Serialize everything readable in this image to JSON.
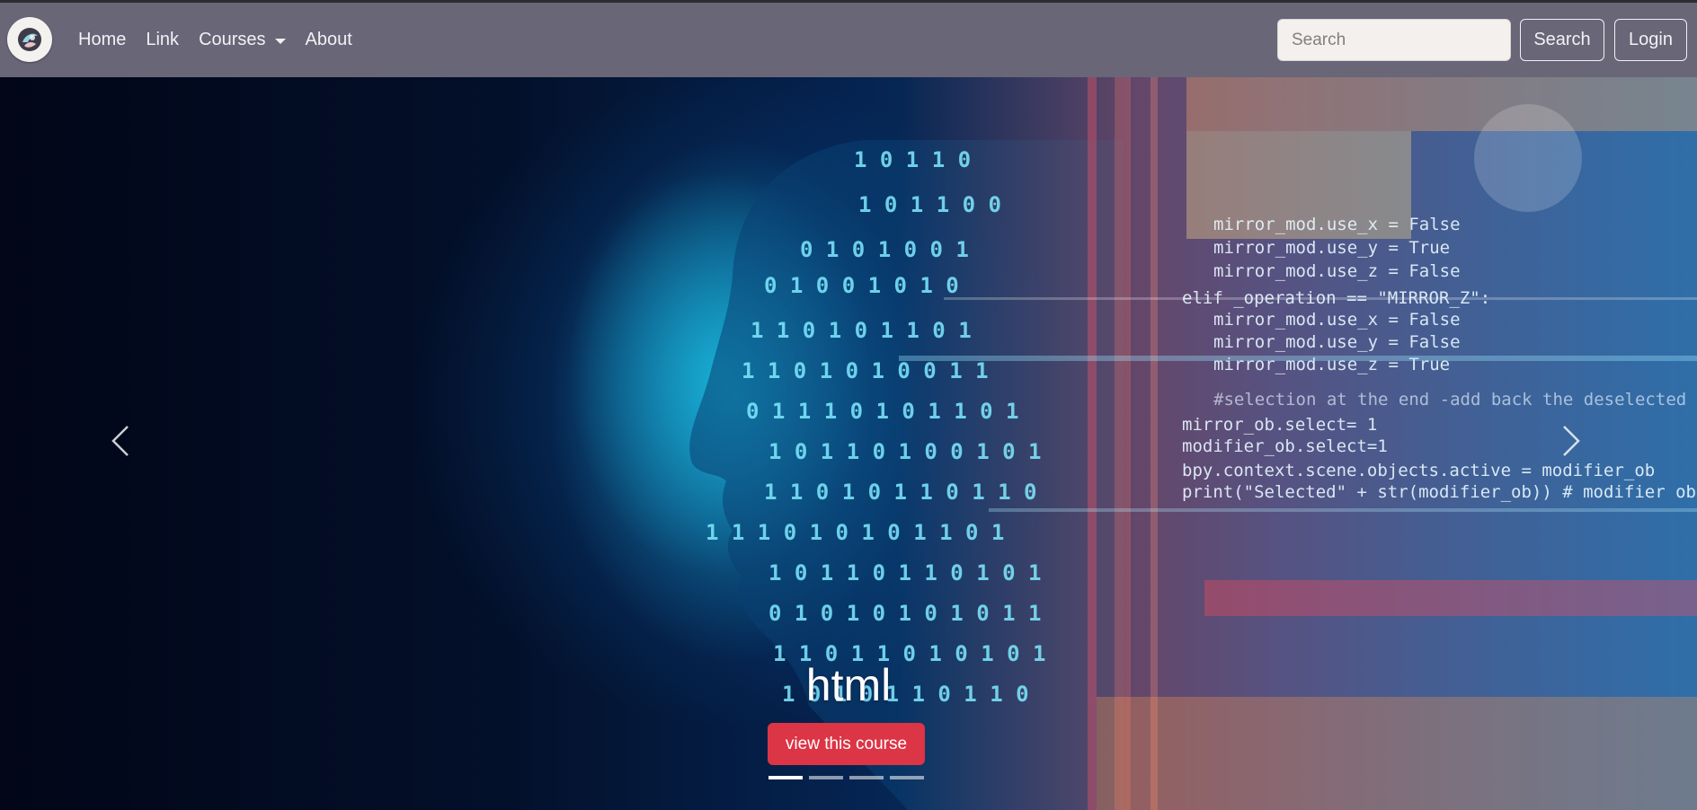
{
  "navbar": {
    "brand_logo": "brand-logo-icon",
    "links": [
      {
        "label": "Home"
      },
      {
        "label": "Link"
      },
      {
        "label": "Courses"
      },
      {
        "label": "About"
      }
    ],
    "search": {
      "placeholder": "Search",
      "value": ""
    },
    "search_button": "Search",
    "login_button": "Login"
  },
  "carousel": {
    "slide": {
      "title": "html",
      "button_label": "view this course"
    },
    "prev_icon": "chevron-left-icon",
    "next_icon": "chevron-right-icon",
    "indicators_count": 4,
    "active_indicator": 1,
    "colors": {
      "button": "#dc3545",
      "navbar": "#686677"
    },
    "background_code_text": [
      "mirror_mod.use_x = False",
      "mirror_mod.use_y = True",
      "mirror_mod.use_z = False",
      "elif _operation == \"MIRROR_Z\":",
      "mirror_mod.use_x = False",
      "mirror_mod.use_y = False",
      "mirror_mod.use_z = True",
      "#selection at the end -add back the deselected m",
      "mirror_ob.select= 1",
      "modifier_ob.select=1",
      "bpy.context.scene.objects.active = modifier_ob",
      "print(\"Selected\" + str(modifier_ob)) # modifier ob i"
    ]
  }
}
